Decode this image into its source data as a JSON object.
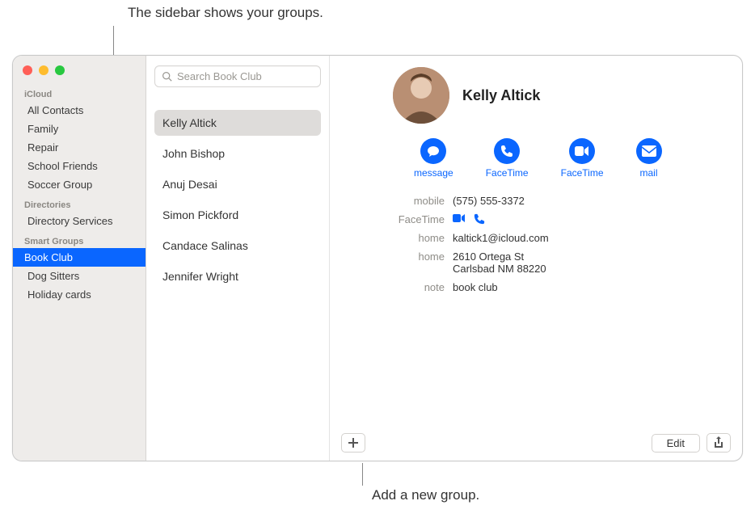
{
  "callouts": {
    "top": "The sidebar shows your groups.",
    "bottom": "Add a new group."
  },
  "sidebar": {
    "sections": [
      {
        "header": "iCloud",
        "items": [
          {
            "label": "All Contacts",
            "selected": false
          },
          {
            "label": "Family",
            "selected": false
          },
          {
            "label": "Repair",
            "selected": false
          },
          {
            "label": "School Friends",
            "selected": false
          },
          {
            "label": "Soccer Group",
            "selected": false
          }
        ]
      },
      {
        "header": "Directories",
        "items": [
          {
            "label": "Directory Services",
            "selected": false
          }
        ]
      },
      {
        "header": "Smart Groups",
        "items": [
          {
            "label": "Book Club",
            "selected": true
          },
          {
            "label": "Dog Sitters",
            "selected": false
          },
          {
            "label": "Holiday cards",
            "selected": false
          }
        ]
      }
    ]
  },
  "search": {
    "placeholder": "Search Book Club"
  },
  "contacts": [
    {
      "name": "Kelly Altick",
      "selected": true
    },
    {
      "name": "John Bishop",
      "selected": false
    },
    {
      "name": "Anuj Desai",
      "selected": false
    },
    {
      "name": "Simon Pickford",
      "selected": false
    },
    {
      "name": "Candace Salinas",
      "selected": false
    },
    {
      "name": "Jennifer Wright",
      "selected": false
    }
  ],
  "card": {
    "name": "Kelly Altick",
    "actions": [
      {
        "label": "message",
        "icon": "message-icon"
      },
      {
        "label": "FaceTime",
        "icon": "phone-icon"
      },
      {
        "label": "FaceTime",
        "icon": "video-icon"
      },
      {
        "label": "mail",
        "icon": "mail-icon"
      }
    ],
    "fields": {
      "mobile_label": "mobile",
      "mobile_value": "(575) 555-3372",
      "facetime_label": "FaceTime",
      "home_email_label": "home",
      "home_email_value": "kaltick1@icloud.com",
      "home_addr_label": "home",
      "home_addr_line1": "2610 Ortega St",
      "home_addr_line2": "Carlsbad NM 88220",
      "note_label": "note",
      "note_value": "book club"
    },
    "edit_label": "Edit"
  }
}
